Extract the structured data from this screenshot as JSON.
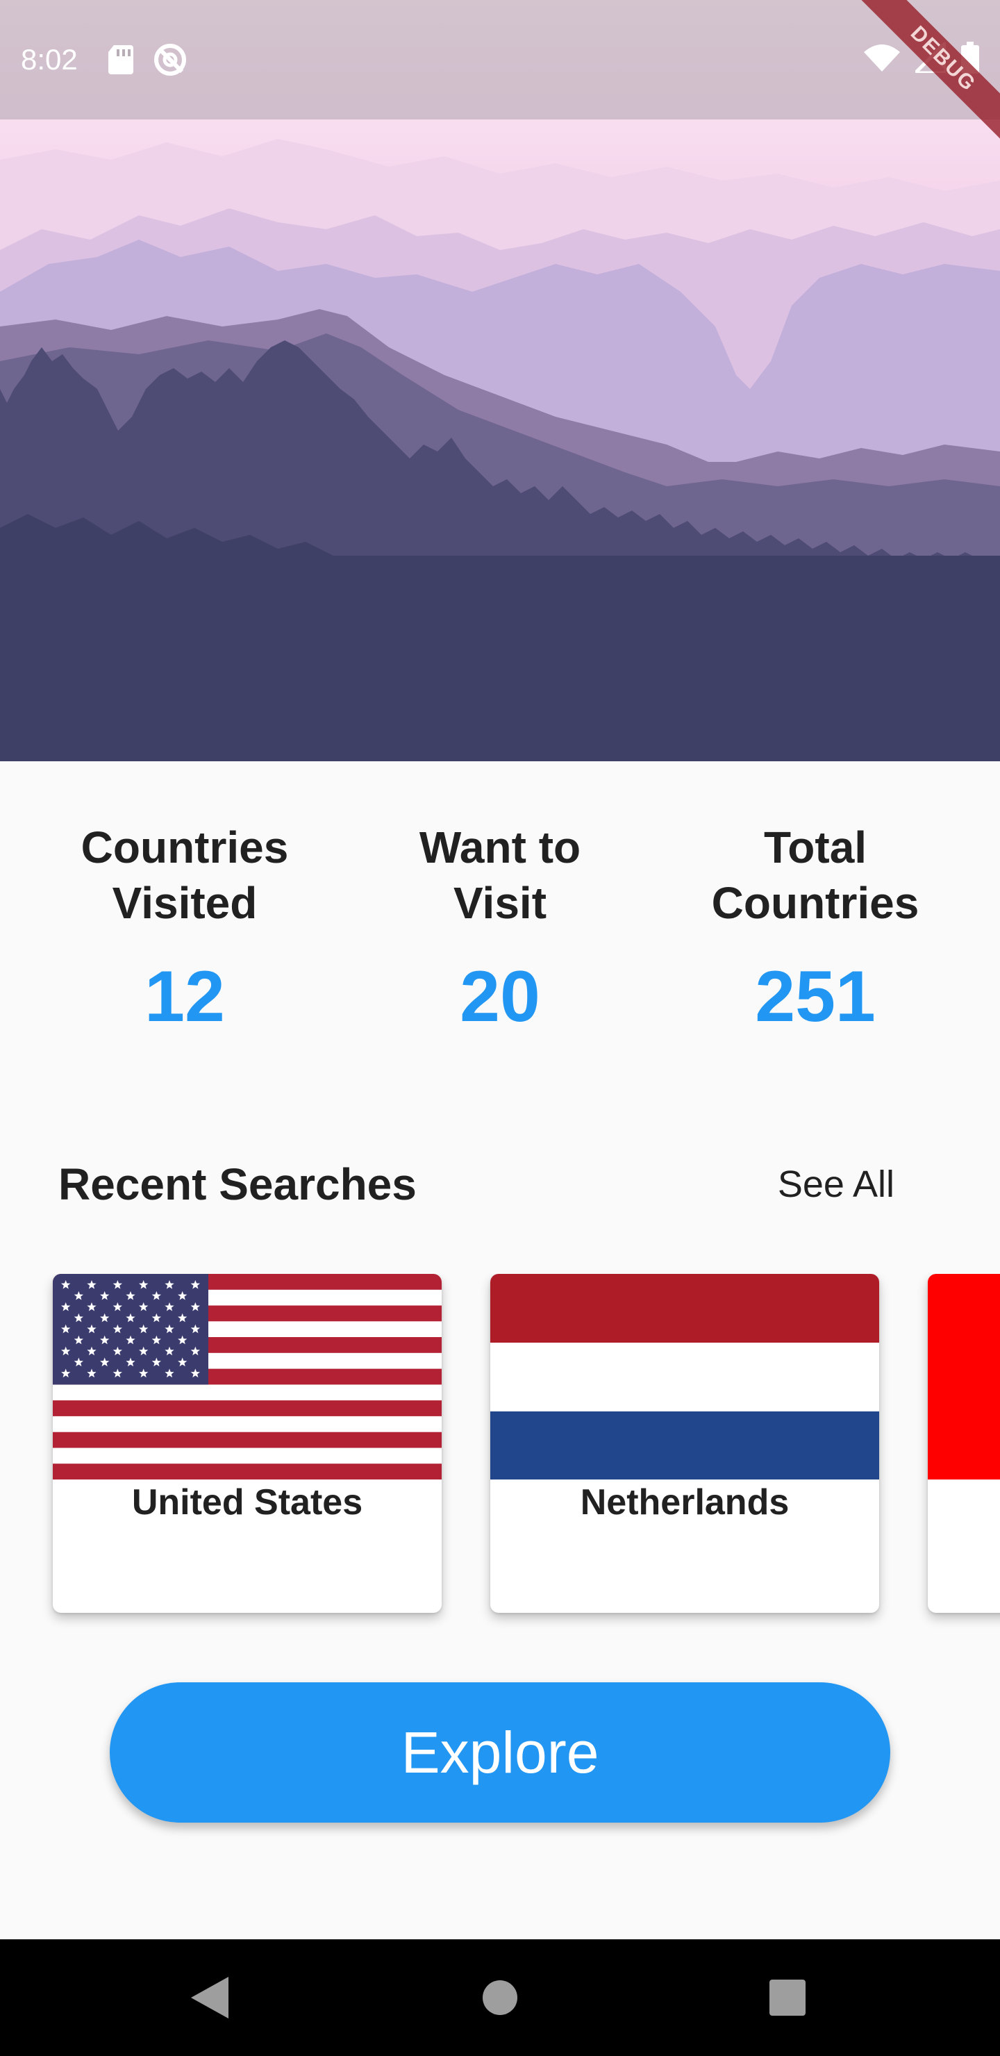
{
  "status_bar": {
    "time": "8:02",
    "left_icons": [
      "sd-card-icon",
      "no-sync-icon"
    ],
    "right_icons": [
      "wifi-icon",
      "cellular-no-signal-icon",
      "battery-icon"
    ]
  },
  "debug_banner": "DEBUG",
  "header_image": {
    "icon": "mountain-landscape-illustration"
  },
  "stats": [
    {
      "label": "Countries\nVisited",
      "value": "12"
    },
    {
      "label": "Want to\nVisit",
      "value": "20"
    },
    {
      "label": "Total\nCountries",
      "value": "251"
    }
  ],
  "recent_searches": {
    "title": "Recent Searches",
    "see_all_label": "See All",
    "cards": [
      {
        "name": "United States",
        "flag_icon": "us-flag-icon"
      },
      {
        "name": "Netherlands",
        "flag_icon": "netherlands-flag-icon"
      },
      {
        "name": "",
        "flag_icon": "red-white-flag-icon"
      }
    ]
  },
  "explore_button": {
    "label": "Explore"
  },
  "nav_bar": {
    "icons": [
      "back-icon",
      "home-icon",
      "recents-icon"
    ]
  },
  "colors": {
    "accent": "#2196f3",
    "background": "#fafafa",
    "landscape_dark": "#3f4066"
  }
}
